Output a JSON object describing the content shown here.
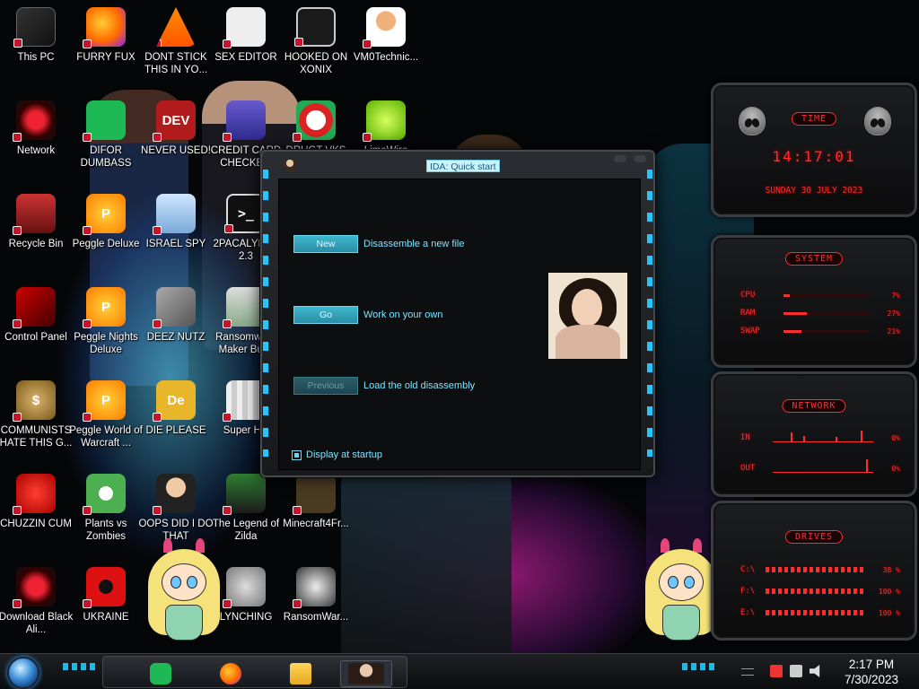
{
  "desktop": {
    "icons": [
      {
        "label": "This PC",
        "icon": "this-pc-icon"
      },
      {
        "label": "FURRY FUX",
        "icon": "firefox-icon"
      },
      {
        "label": "DONT STICK THIS IN YO...",
        "icon": "vlc-icon"
      },
      {
        "label": "SEX EDITOR",
        "icon": "hxd-icon"
      },
      {
        "label": "HOOKED ON XONIX",
        "icon": "hooked-icon"
      },
      {
        "label": "VM0Technic...",
        "icon": "doctor-icon"
      },
      {
        "label": "Network",
        "icon": "network-icon"
      },
      {
        "label": "DIFOR DUMBASS",
        "icon": "spotify-icon"
      },
      {
        "label": "NEVER USED!",
        "icon": "dev-icon",
        "glyph": "DEV"
      },
      {
        "label": "CREDIT CARD CHECKE...",
        "icon": "credit-card-icon"
      },
      {
        "label": "DRUGT VKS",
        "icon": "santa-icon"
      },
      {
        "label": "LimeWire",
        "icon": "limewire-icon"
      },
      {
        "label": "Recycle Bin",
        "icon": "recycle-bin-icon"
      },
      {
        "label": "Peggle Deluxe",
        "icon": "peggle-icon",
        "glyph": "P"
      },
      {
        "label": "ISRAEL SPY",
        "icon": "israel-icon"
      },
      {
        "label": "2PACALYPSE 2.3",
        "icon": "terminal-icon",
        "glyph": ">_"
      },
      {
        "label": "Control Panel",
        "icon": "control-panel-icon"
      },
      {
        "label": "Peggle Nights Deluxe",
        "icon": "peggle-icon",
        "glyph": "P"
      },
      {
        "label": "DEEZ NUTZ",
        "icon": "deez-icon"
      },
      {
        "label": "Ransomware Maker Build",
        "icon": "ransom-maker-icon"
      },
      {
        "label": "COMMUNISTS HATE THIS G...",
        "icon": "money-bag-icon",
        "glyph": "$"
      },
      {
        "label": "Peggle World of Warcraft ...",
        "icon": "peggle-icon",
        "glyph": "P"
      },
      {
        "label": "DIE PLEASE",
        "icon": "die-icon",
        "glyph": "De"
      },
      {
        "label": "Super Hik",
        "icon": "pixel-icon"
      },
      {
        "label": "CHUZZIN CUM",
        "icon": "chuzzle-icon"
      },
      {
        "label": "Plants vs Zombies",
        "icon": "plants-icon"
      },
      {
        "label": "OOPS DID I DO THAT",
        "icon": "portrait-icon"
      },
      {
        "label": "The Legend of Zilda",
        "icon": "zelda-icon"
      },
      {
        "label": "Minecraft4Fr...",
        "icon": "minecraft-icon"
      },
      {
        "label": "Download Black Ali...",
        "icon": "alien-icon"
      },
      {
        "label": "UKRAINE",
        "icon": "radiation-icon"
      },
      {
        "label": "LYNCHING",
        "icon": "gear-icon"
      },
      {
        "label": "RansomWar...",
        "icon": "skull-icon"
      }
    ]
  },
  "ida": {
    "title": "IDA: Quick start",
    "buttons": [
      {
        "label": "New",
        "desc": "Disassemble a new file",
        "enabled": true
      },
      {
        "label": "Go",
        "desc": "Work on your own",
        "enabled": true
      },
      {
        "label": "Previous",
        "desc": "Load the old disassembly",
        "enabled": false
      }
    ],
    "checkbox_label": "Display at startup",
    "checkbox_checked": true
  },
  "gadgets": {
    "time": {
      "title": "TIME",
      "clock": "14:17:01",
      "date": "SUNDAY 30 JULY 2023"
    },
    "system": {
      "title": "SYSTEM",
      "rows": [
        {
          "label": "CPU",
          "value": "7%",
          "percent": 7
        },
        {
          "label": "RAM",
          "value": "27%",
          "percent": 27
        },
        {
          "label": "SWAP",
          "value": "21%",
          "percent": 21
        }
      ]
    },
    "network": {
      "title": "NETWORK",
      "rows": [
        {
          "label": "IN",
          "value": "0%"
        },
        {
          "label": "OUT",
          "value": "0%"
        }
      ]
    },
    "drives": {
      "title": "DRIVES",
      "rows": [
        {
          "label": "C:\\",
          "value": "38 %"
        },
        {
          "label": "F:\\",
          "value": "100 %"
        },
        {
          "label": "E:\\",
          "value": "100 %"
        }
      ]
    }
  },
  "taskbar": {
    "pinned": [
      {
        "name": "spotify",
        "icon": "spotify-icon"
      },
      {
        "name": "firefox",
        "icon": "firefox-icon"
      },
      {
        "name": "file-explorer",
        "icon": "folder-icon"
      },
      {
        "name": "ida",
        "icon": "ida-portrait-icon",
        "active": true
      }
    ],
    "clock": {
      "time": "2:17 PM",
      "date": "7/30/2023"
    }
  },
  "colors": {
    "accent_cyan": "#24c6ff",
    "gadget_red": "#ff2d2d",
    "ida_text": "#7fe3ff",
    "ida_button": "#3fb7cf"
  }
}
